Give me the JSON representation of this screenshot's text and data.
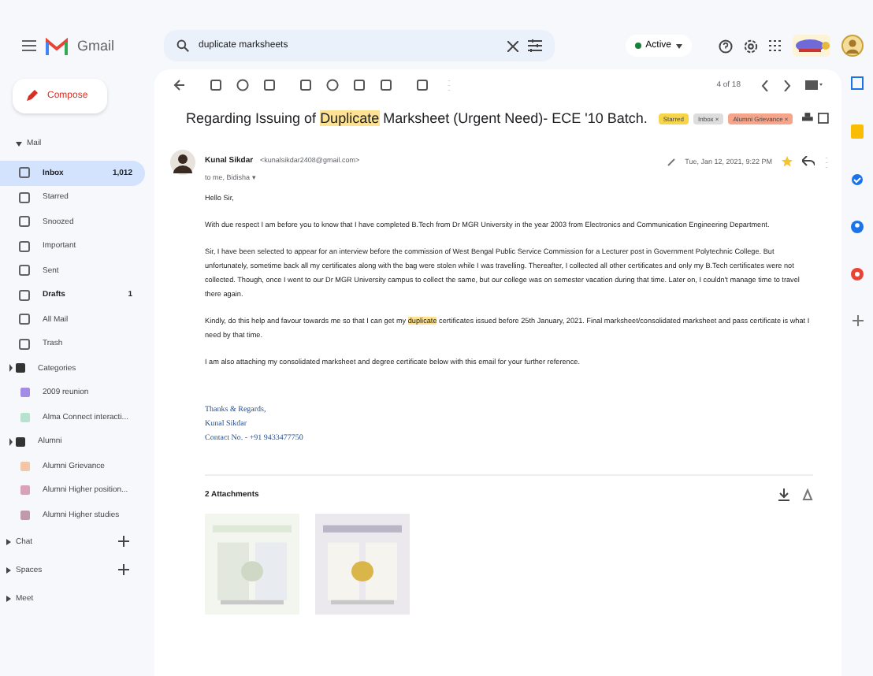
{
  "app": {
    "name": "Gmail"
  },
  "search": {
    "value": "duplicate marksheets"
  },
  "status": {
    "label": "Active"
  },
  "compose": "Compose",
  "sidebar": {
    "section": "Mail",
    "items": [
      {
        "label": "Inbox",
        "count": "1,012",
        "selected": true,
        "bold": true
      },
      {
        "label": "Starred",
        "selected": false,
        "bold": false
      },
      {
        "label": "Snoozed",
        "selected": false,
        "bold": false
      },
      {
        "label": "Important",
        "selected": false,
        "bold": false
      },
      {
        "label": "Sent",
        "selected": false,
        "bold": false
      },
      {
        "label": "Drafts",
        "count": "1",
        "selected": false,
        "bold": true
      },
      {
        "label": "All Mail",
        "selected": false,
        "bold": false
      },
      {
        "label": "Trash",
        "selected": false,
        "bold": false
      }
    ],
    "labels": [
      {
        "label": "Categories",
        "kind": "group"
      },
      {
        "label": "2009 reunion",
        "kind": "label",
        "color": "#a48be6"
      },
      {
        "label": "Alma Connect interacti...",
        "kind": "label",
        "color": "#b7e2cf"
      },
      {
        "label": "Alumni",
        "kind": "group"
      },
      {
        "label": "Alumni Grievance",
        "kind": "label",
        "color": "#f3c6aa"
      },
      {
        "label": "Alumni Higher position...",
        "kind": "label",
        "color": "#d9a3b7"
      },
      {
        "label": "Alumni Higher studies",
        "kind": "label",
        "color": "#c09aac"
      }
    ],
    "sections": [
      {
        "label": "Chat",
        "add": true
      },
      {
        "label": "Spaces",
        "add": true
      },
      {
        "label": "Meet",
        "add": false
      }
    ]
  },
  "pager": "4 of 18",
  "email": {
    "subject_before": "Regarding Issuing of ",
    "subject_highlight": "Duplicate",
    "subject_after": " Marksheet (Urgent Need)- ECE '10 Batch.",
    "tags": [
      {
        "label": "Starred",
        "color": "#f7d54a"
      },
      {
        "label": "Inbox ×",
        "color": "#dddddd"
      },
      {
        "label": "Alumni Grievance ×",
        "color": "#f6a58a"
      }
    ],
    "sender": "Kunal Sikdar",
    "address": "<kunalsikdar2408@gmail.com>",
    "to": "to me, Bidisha ▾",
    "date": "Tue, Jan 12, 2021, 9:22 PM",
    "greeting": "Hello Sir,",
    "paragraphs": [
      {
        "before": "With due respect I am before you to know that I have completed B.Tech from Dr MGR University in the year 2003 from Electronics and Communication Engineering Department."
      },
      {
        "before": "Sir, I have been selected to appear for an interview before the commission of West Bengal Public Service Commission for a Lecturer post in Government Polytechnic College. But unfortunately, sometime back all my certificates along with the bag were stolen while I was travelling. Thereafter, I collected all other certificates and only my B.Tech certificates were not collected. Though, once I went to our Dr MGR University campus to collect the same, but our college was on semester vacation during that time. Later on, I couldn't manage time to travel there again."
      },
      {
        "before": " Kindly, do this help and favour towards me so that I can get my ",
        "highlight": "duplicate",
        "after": " certificates issued before 25th January, 2021. Final marksheet/consolidated marksheet and pass certificate is what I need by that time."
      },
      {
        "before": "I am also attaching my consolidated marksheet and degree certificate below with this email for your further reference."
      }
    ],
    "signature": [
      "Thanks & Regards,",
      "Kunal Sikdar",
      "Contact No. - +91 9433477750"
    ],
    "attachments": {
      "title": "2 Attachments"
    }
  }
}
